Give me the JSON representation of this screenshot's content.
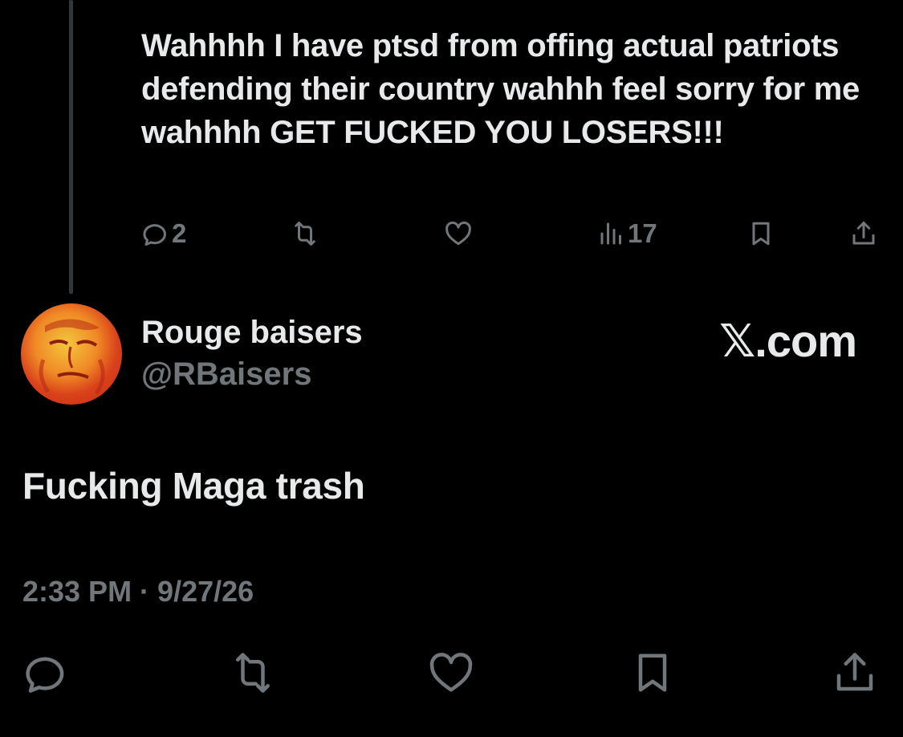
{
  "parent_tweet": {
    "text": "Wahhhh I have ptsd from offing actual patriots defending their country wahhh feel sorry for me wahhhh GET FUCKED YOU LOSERS!!!",
    "actions": {
      "reply_count": "2",
      "views_count": "17"
    }
  },
  "reply_tweet": {
    "author": {
      "display_name": "Rouge baisers",
      "handle": "@RBaisers"
    },
    "text": "Fucking Maga trash",
    "timestamp": "2:33 PM · 9/27/26"
  },
  "watermark": {
    "label": "𝕏.com"
  },
  "icons": {
    "reply": "reply-icon",
    "retweet": "retweet-icon",
    "like": "heart-icon",
    "views": "views-icon",
    "bookmark": "bookmark-icon",
    "share": "share-icon"
  },
  "colors": {
    "background": "#000000",
    "text_primary": "#e7e9ea",
    "text_secondary": "#71767b",
    "thread_line": "#333639"
  }
}
